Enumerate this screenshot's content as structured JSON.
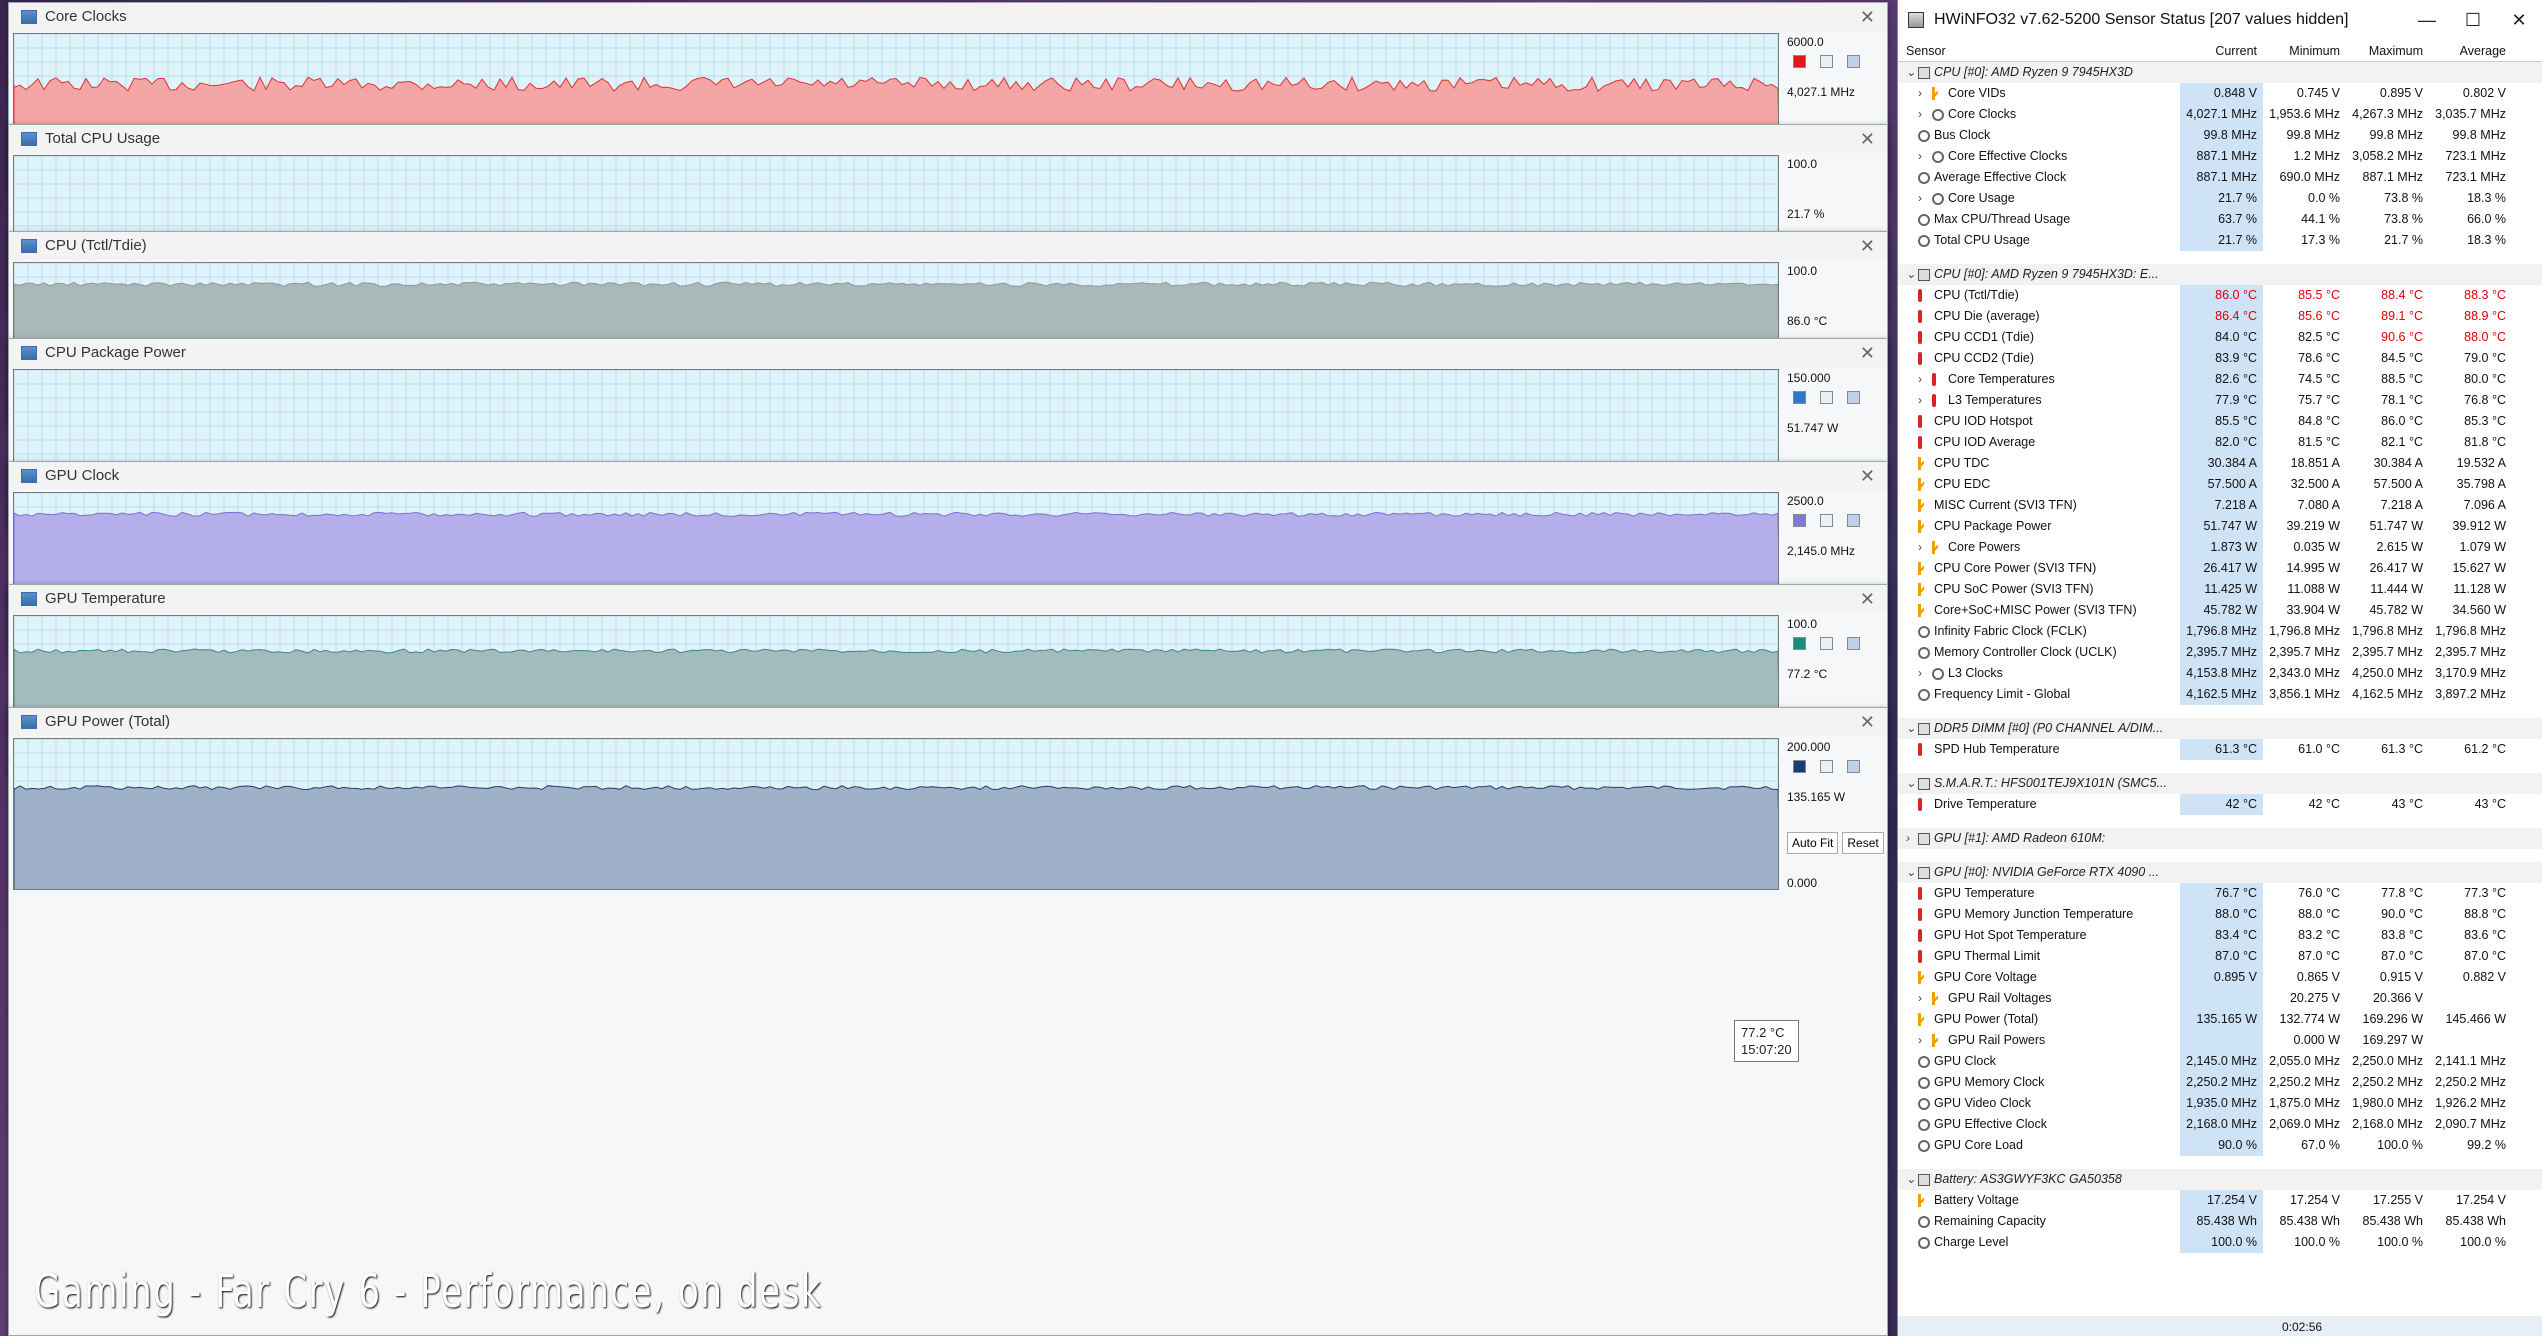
{
  "graphs": [
    {
      "title": "Core Clocks",
      "max": "6000.0",
      "current": "4,027.1 MHz",
      "min": "0.0",
      "color": "#f4a5a5",
      "line": "#e03030",
      "level": 0.67,
      "swatches": [
        "#e01818",
        "#e8f0f8",
        "#c0d0e8"
      ]
    },
    {
      "title": "Total CPU Usage",
      "max": "100.0",
      "current": "21.7 %",
      "min": "0.0",
      "color": "#c8d4e4",
      "line": "#503050",
      "level": 0.05,
      "swatches": []
    },
    {
      "title": "CPU (Tctl/Tdie)",
      "max": "100.0",
      "current": "86.0 °C",
      "min": "0.0",
      "color": "#a9b9b9",
      "line": "#8a9a9a",
      "level": 0.86,
      "swatches": []
    },
    {
      "title": "CPU Package Power",
      "max": "150.000",
      "current": "51.747 W",
      "min": "0.000",
      "color": "#8fb0e8",
      "line": "#3a6ed8",
      "level": 0.28,
      "swatches": [
        "#2f77c8",
        "#e8f0f8",
        "#c0d0e8"
      ]
    },
    {
      "title": "GPU Clock",
      "max": "2500.0",
      "current": "2,145.0 MHz",
      "min": "0.0",
      "color": "#b4aeea",
      "line": "#7a70d0",
      "level": 0.86,
      "swatches": [
        "#7f78d0",
        "#e8f0f8",
        "#c0d0e8"
      ]
    },
    {
      "title": "GPU Temperature",
      "max": "100.0",
      "current": "77.2 °C",
      "min": "0.0",
      "color": "#a3bcbb",
      "line": "#3a8a80",
      "level": 0.77,
      "swatches": [
        "#1f8a80",
        "#e8f0f8",
        "#c0d0e8"
      ]
    },
    {
      "title": "GPU Power (Total)",
      "max": "200.000",
      "current": "135.165 W",
      "min": "0.000",
      "color": "#9fb1c8",
      "line": "#1d3f70",
      "level": 0.68,
      "swatches": [
        "#163d78",
        "#e8f0f8",
        "#c0d0e8"
      ]
    }
  ],
  "buttons": {
    "autofit": "Auto Fit",
    "reset": "Reset"
  },
  "tooltip": {
    "value": "77.2 °C",
    "time": "15:07:20"
  },
  "caption": "Gaming - Far Cry 6 - Performance, on desk",
  "sensor": {
    "title": "HWiNFO32 v7.62-5200 Sensor Status [207 values hidden]",
    "columns": [
      "Sensor",
      "Current",
      "Minimum",
      "Maximum",
      "Average"
    ],
    "footer_time": "0:02:56",
    "rows": [
      {
        "t": "g",
        "name": "CPU [#0]: AMD Ryzen 9 7945HX3D",
        "exp": "v"
      },
      {
        "name": "Core VIDs",
        "icon": "bolt",
        "exp": ">",
        "ind": 2,
        "v": [
          "0.848 V",
          "0.745 V",
          "0.895 V",
          "0.802 V"
        ]
      },
      {
        "name": "Core Clocks",
        "icon": "clock",
        "exp": ">",
        "ind": 2,
        "v": [
          "4,027.1 MHz",
          "1,953.6 MHz",
          "4,267.3 MHz",
          "3,035.7 MHz"
        ]
      },
      {
        "name": "Bus Clock",
        "icon": "clock",
        "ind": 1,
        "v": [
          "99.8 MHz",
          "99.8 MHz",
          "99.8 MHz",
          "99.8 MHz"
        ]
      },
      {
        "name": "Core Effective Clocks",
        "icon": "clock",
        "exp": ">",
        "ind": 2,
        "v": [
          "887.1 MHz",
          "1.2 MHz",
          "3,058.2 MHz",
          "723.1 MHz"
        ]
      },
      {
        "name": "Average Effective Clock",
        "icon": "clock",
        "ind": 1,
        "v": [
          "887.1 MHz",
          "690.0 MHz",
          "887.1 MHz",
          "723.1 MHz"
        ]
      },
      {
        "name": "Core Usage",
        "icon": "clock",
        "exp": ">",
        "ind": 2,
        "v": [
          "21.7 %",
          "0.0 %",
          "73.8 %",
          "18.3 %"
        ]
      },
      {
        "name": "Max CPU/Thread Usage",
        "icon": "clock",
        "ind": 1,
        "v": [
          "63.7 %",
          "44.1 %",
          "73.8 %",
          "66.0 %"
        ]
      },
      {
        "name": "Total CPU Usage",
        "icon": "clock",
        "ind": 1,
        "v": [
          "21.7 %",
          "17.3 %",
          "21.7 %",
          "18.3 %"
        ]
      },
      {
        "t": "s"
      },
      {
        "t": "g",
        "name": "CPU [#0]: AMD Ryzen 9 7945HX3D: E...",
        "exp": "v"
      },
      {
        "name": "CPU (Tctl/Tdie)",
        "icon": "therm",
        "ind": 1,
        "hot": true,
        "v": [
          "86.0 °C",
          "85.5 °C",
          "88.4 °C",
          "88.3 °C"
        ]
      },
      {
        "name": "CPU Die (average)",
        "icon": "therm",
        "ind": 1,
        "hot": true,
        "v": [
          "86.4 °C",
          "85.6 °C",
          "89.1 °C",
          "88.9 °C"
        ]
      },
      {
        "name": "CPU CCD1 (Tdie)",
        "icon": "therm",
        "ind": 1,
        "hotcols": [
          2,
          3
        ],
        "v": [
          "84.0 °C",
          "82.5 °C",
          "90.6 °C",
          "88.0 °C"
        ]
      },
      {
        "name": "CPU CCD2 (Tdie)",
        "icon": "therm",
        "ind": 1,
        "v": [
          "83.9 °C",
          "78.6 °C",
          "84.5 °C",
          "79.0 °C"
        ]
      },
      {
        "name": "Core Temperatures",
        "icon": "therm",
        "exp": ">",
        "ind": 2,
        "v": [
          "82.6 °C",
          "74.5 °C",
          "88.5 °C",
          "80.0 °C"
        ]
      },
      {
        "name": "L3 Temperatures",
        "icon": "therm",
        "exp": ">",
        "ind": 2,
        "v": [
          "77.9 °C",
          "75.7 °C",
          "78.1 °C",
          "76.8 °C"
        ]
      },
      {
        "name": "CPU IOD Hotspot",
        "icon": "therm",
        "ind": 1,
        "v": [
          "85.5 °C",
          "84.8 °C",
          "86.0 °C",
          "85.3 °C"
        ]
      },
      {
        "name": "CPU IOD Average",
        "icon": "therm",
        "ind": 1,
        "v": [
          "82.0 °C",
          "81.5 °C",
          "82.1 °C",
          "81.8 °C"
        ]
      },
      {
        "name": "CPU TDC",
        "icon": "bolt",
        "ind": 1,
        "v": [
          "30.384 A",
          "18.851 A",
          "30.384 A",
          "19.532 A"
        ]
      },
      {
        "name": "CPU EDC",
        "icon": "bolt",
        "ind": 1,
        "v": [
          "57.500 A",
          "32.500 A",
          "57.500 A",
          "35.798 A"
        ]
      },
      {
        "name": "MISC Current (SVI3 TFN)",
        "icon": "bolt",
        "ind": 1,
        "v": [
          "7.218 A",
          "7.080 A",
          "7.218 A",
          "7.096 A"
        ]
      },
      {
        "name": "CPU Package Power",
        "icon": "bolt",
        "ind": 1,
        "v": [
          "51.747 W",
          "39.219 W",
          "51.747 W",
          "39.912 W"
        ]
      },
      {
        "name": "Core Powers",
        "icon": "bolt",
        "exp": ">",
        "ind": 2,
        "v": [
          "1.873 W",
          "0.035 W",
          "2.615 W",
          "1.079 W"
        ]
      },
      {
        "name": "CPU Core Power (SVI3 TFN)",
        "icon": "bolt",
        "ind": 1,
        "v": [
          "26.417 W",
          "14.995 W",
          "26.417 W",
          "15.627 W"
        ]
      },
      {
        "name": "CPU SoC Power (SVI3 TFN)",
        "icon": "bolt",
        "ind": 1,
        "v": [
          "11.425 W",
          "11.088 W",
          "11.444 W",
          "11.128 W"
        ]
      },
      {
        "name": "Core+SoC+MISC Power (SVI3 TFN)",
        "icon": "bolt",
        "ind": 1,
        "v": [
          "45.782 W",
          "33.904 W",
          "45.782 W",
          "34.560 W"
        ]
      },
      {
        "name": "Infinity Fabric Clock (FCLK)",
        "icon": "clock",
        "ind": 1,
        "v": [
          "1,796.8 MHz",
          "1,796.8 MHz",
          "1,796.8 MHz",
          "1,796.8 MHz"
        ]
      },
      {
        "name": "Memory Controller Clock (UCLK)",
        "icon": "clock",
        "ind": 1,
        "v": [
          "2,395.7 MHz",
          "2,395.7 MHz",
          "2,395.7 MHz",
          "2,395.7 MHz"
        ]
      },
      {
        "name": "L3 Clocks",
        "icon": "clock",
        "exp": ">",
        "ind": 2,
        "v": [
          "4,153.8 MHz",
          "2,343.0 MHz",
          "4,250.0 MHz",
          "3,170.9 MHz"
        ]
      },
      {
        "name": "Frequency Limit - Global",
        "icon": "clock",
        "ind": 1,
        "v": [
          "4,162.5 MHz",
          "3,856.1 MHz",
          "4,162.5 MHz",
          "3,897.2 MHz"
        ]
      },
      {
        "t": "s"
      },
      {
        "t": "g",
        "name": "DDR5 DIMM [#0] (P0 CHANNEL A/DIM...",
        "exp": "v"
      },
      {
        "name": "SPD Hub Temperature",
        "icon": "therm",
        "ind": 1,
        "v": [
          "61.3 °C",
          "61.0 °C",
          "61.3 °C",
          "61.2 °C"
        ]
      },
      {
        "t": "s"
      },
      {
        "t": "g",
        "name": "S.M.A.R.T.: HFS001TEJ9X101N (SMC5...",
        "exp": "v"
      },
      {
        "name": "Drive Temperature",
        "icon": "therm",
        "ind": 1,
        "v": [
          "42 °C",
          "42 °C",
          "43 °C",
          "43 °C"
        ]
      },
      {
        "t": "s"
      },
      {
        "t": "g",
        "name": "GPU [#1]: AMD Radeon 610M:",
        "exp": ">"
      },
      {
        "t": "s"
      },
      {
        "t": "g",
        "name": "GPU [#0]: NVIDIA GeForce RTX 4090 ...",
        "exp": "v"
      },
      {
        "name": "GPU Temperature",
        "icon": "therm",
        "ind": 1,
        "v": [
          "76.7 °C",
          "76.0 °C",
          "77.8 °C",
          "77.3 °C"
        ]
      },
      {
        "name": "GPU Memory Junction Temperature",
        "icon": "therm",
        "ind": 1,
        "v": [
          "88.0 °C",
          "88.0 °C",
          "90.0 °C",
          "88.8 °C"
        ]
      },
      {
        "name": "GPU Hot Spot Temperature",
        "icon": "therm",
        "ind": 1,
        "v": [
          "83.4 °C",
          "83.2 °C",
          "83.8 °C",
          "83.6 °C"
        ]
      },
      {
        "name": "GPU Thermal Limit",
        "icon": "therm",
        "ind": 1,
        "v": [
          "87.0 °C",
          "87.0 °C",
          "87.0 °C",
          "87.0 °C"
        ]
      },
      {
        "name": "GPU Core Voltage",
        "icon": "bolt",
        "ind": 1,
        "v": [
          "0.895 V",
          "0.865 V",
          "0.915 V",
          "0.882 V"
        ]
      },
      {
        "name": "GPU Rail Voltages",
        "icon": "bolt",
        "exp": ">",
        "ind": 2,
        "v": [
          "",
          "20.275 V",
          "20.366 V",
          ""
        ]
      },
      {
        "name": "GPU Power (Total)",
        "icon": "bolt",
        "ind": 1,
        "v": [
          "135.165 W",
          "132.774 W",
          "169.296 W",
          "145.466 W"
        ]
      },
      {
        "name": "GPU Rail Powers",
        "icon": "bolt",
        "exp": ">",
        "ind": 2,
        "v": [
          "",
          "0.000 W",
          "169.297 W",
          ""
        ]
      },
      {
        "name": "GPU Clock",
        "icon": "clock",
        "ind": 1,
        "v": [
          "2,145.0 MHz",
          "2,055.0 MHz",
          "2,250.0 MHz",
          "2,141.1 MHz"
        ]
      },
      {
        "name": "GPU Memory Clock",
        "icon": "clock",
        "ind": 1,
        "v": [
          "2,250.2 MHz",
          "2,250.2 MHz",
          "2,250.2 MHz",
          "2,250.2 MHz"
        ]
      },
      {
        "name": "GPU Video Clock",
        "icon": "clock",
        "ind": 1,
        "v": [
          "1,935.0 MHz",
          "1,875.0 MHz",
          "1,980.0 MHz",
          "1,926.2 MHz"
        ]
      },
      {
        "name": "GPU Effective Clock",
        "icon": "clock",
        "ind": 1,
        "v": [
          "2,168.0 MHz",
          "2,069.0 MHz",
          "2,168.0 MHz",
          "2,090.7 MHz"
        ]
      },
      {
        "name": "GPU Core Load",
        "icon": "clock",
        "ind": 1,
        "v": [
          "90.0 %",
          "67.0 %",
          "100.0 %",
          "99.2 %"
        ]
      },
      {
        "t": "s"
      },
      {
        "t": "g",
        "name": "Battery: AS3GWYF3KC GA50358",
        "exp": "v"
      },
      {
        "name": "Battery Voltage",
        "icon": "bolt",
        "ind": 1,
        "v": [
          "17.254 V",
          "17.254 V",
          "17.255 V",
          "17.254 V"
        ]
      },
      {
        "name": "Remaining Capacity",
        "icon": "clock",
        "ind": 1,
        "v": [
          "85.438 Wh",
          "85.438 Wh",
          "85.438 Wh",
          "85.438 Wh"
        ]
      },
      {
        "name": "Charge Level",
        "icon": "clock",
        "ind": 1,
        "v": [
          "100.0 %",
          "100.0 %",
          "100.0 %",
          "100.0 %"
        ]
      }
    ]
  }
}
